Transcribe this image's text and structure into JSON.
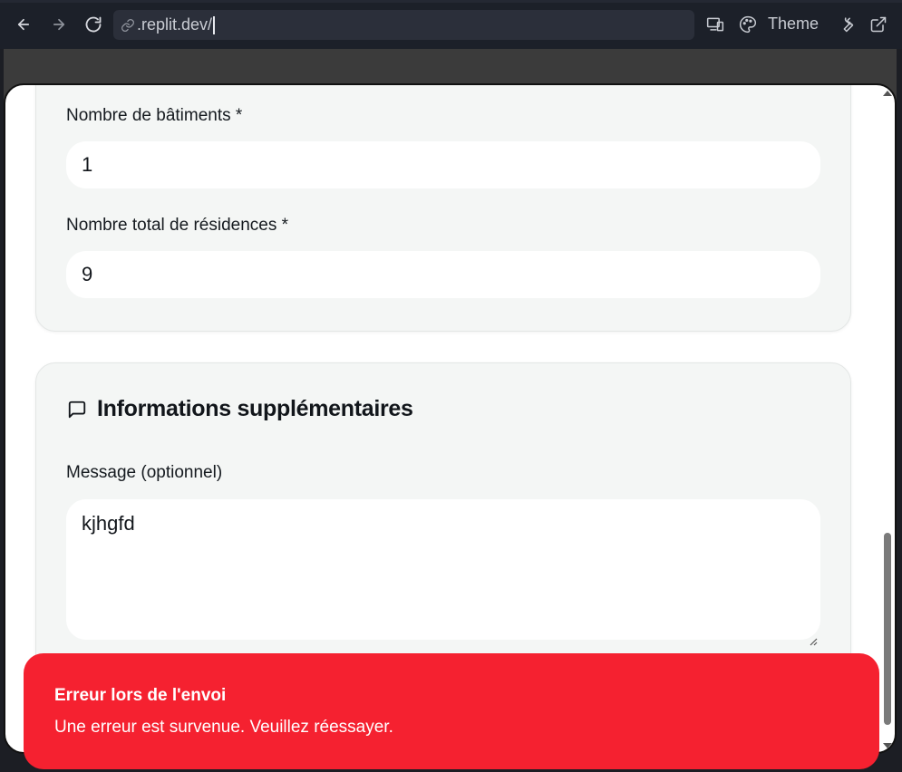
{
  "browser": {
    "url": ".replit.dev/",
    "theme_label": "Theme"
  },
  "form": {
    "buildings": {
      "label": "Nombre de bâtiments *",
      "value": "1"
    },
    "residences": {
      "label": "Nombre total de résidences *",
      "value": "9"
    }
  },
  "additional": {
    "title": "Informations supplémentaires",
    "message_label": "Message (optionnel)",
    "message_value": "kjhgfd"
  },
  "toast": {
    "title": "Erreur lors de l'envoi",
    "description": "Une erreur est survenue. Veuillez réessayer.",
    "color": "#f52130"
  },
  "icons": [
    "back-arrow-icon",
    "forward-arrow-icon",
    "reload-icon",
    "link-icon",
    "devices-icon",
    "palette-icon",
    "wrench-icon",
    "external-link-icon",
    "message-square-icon"
  ]
}
